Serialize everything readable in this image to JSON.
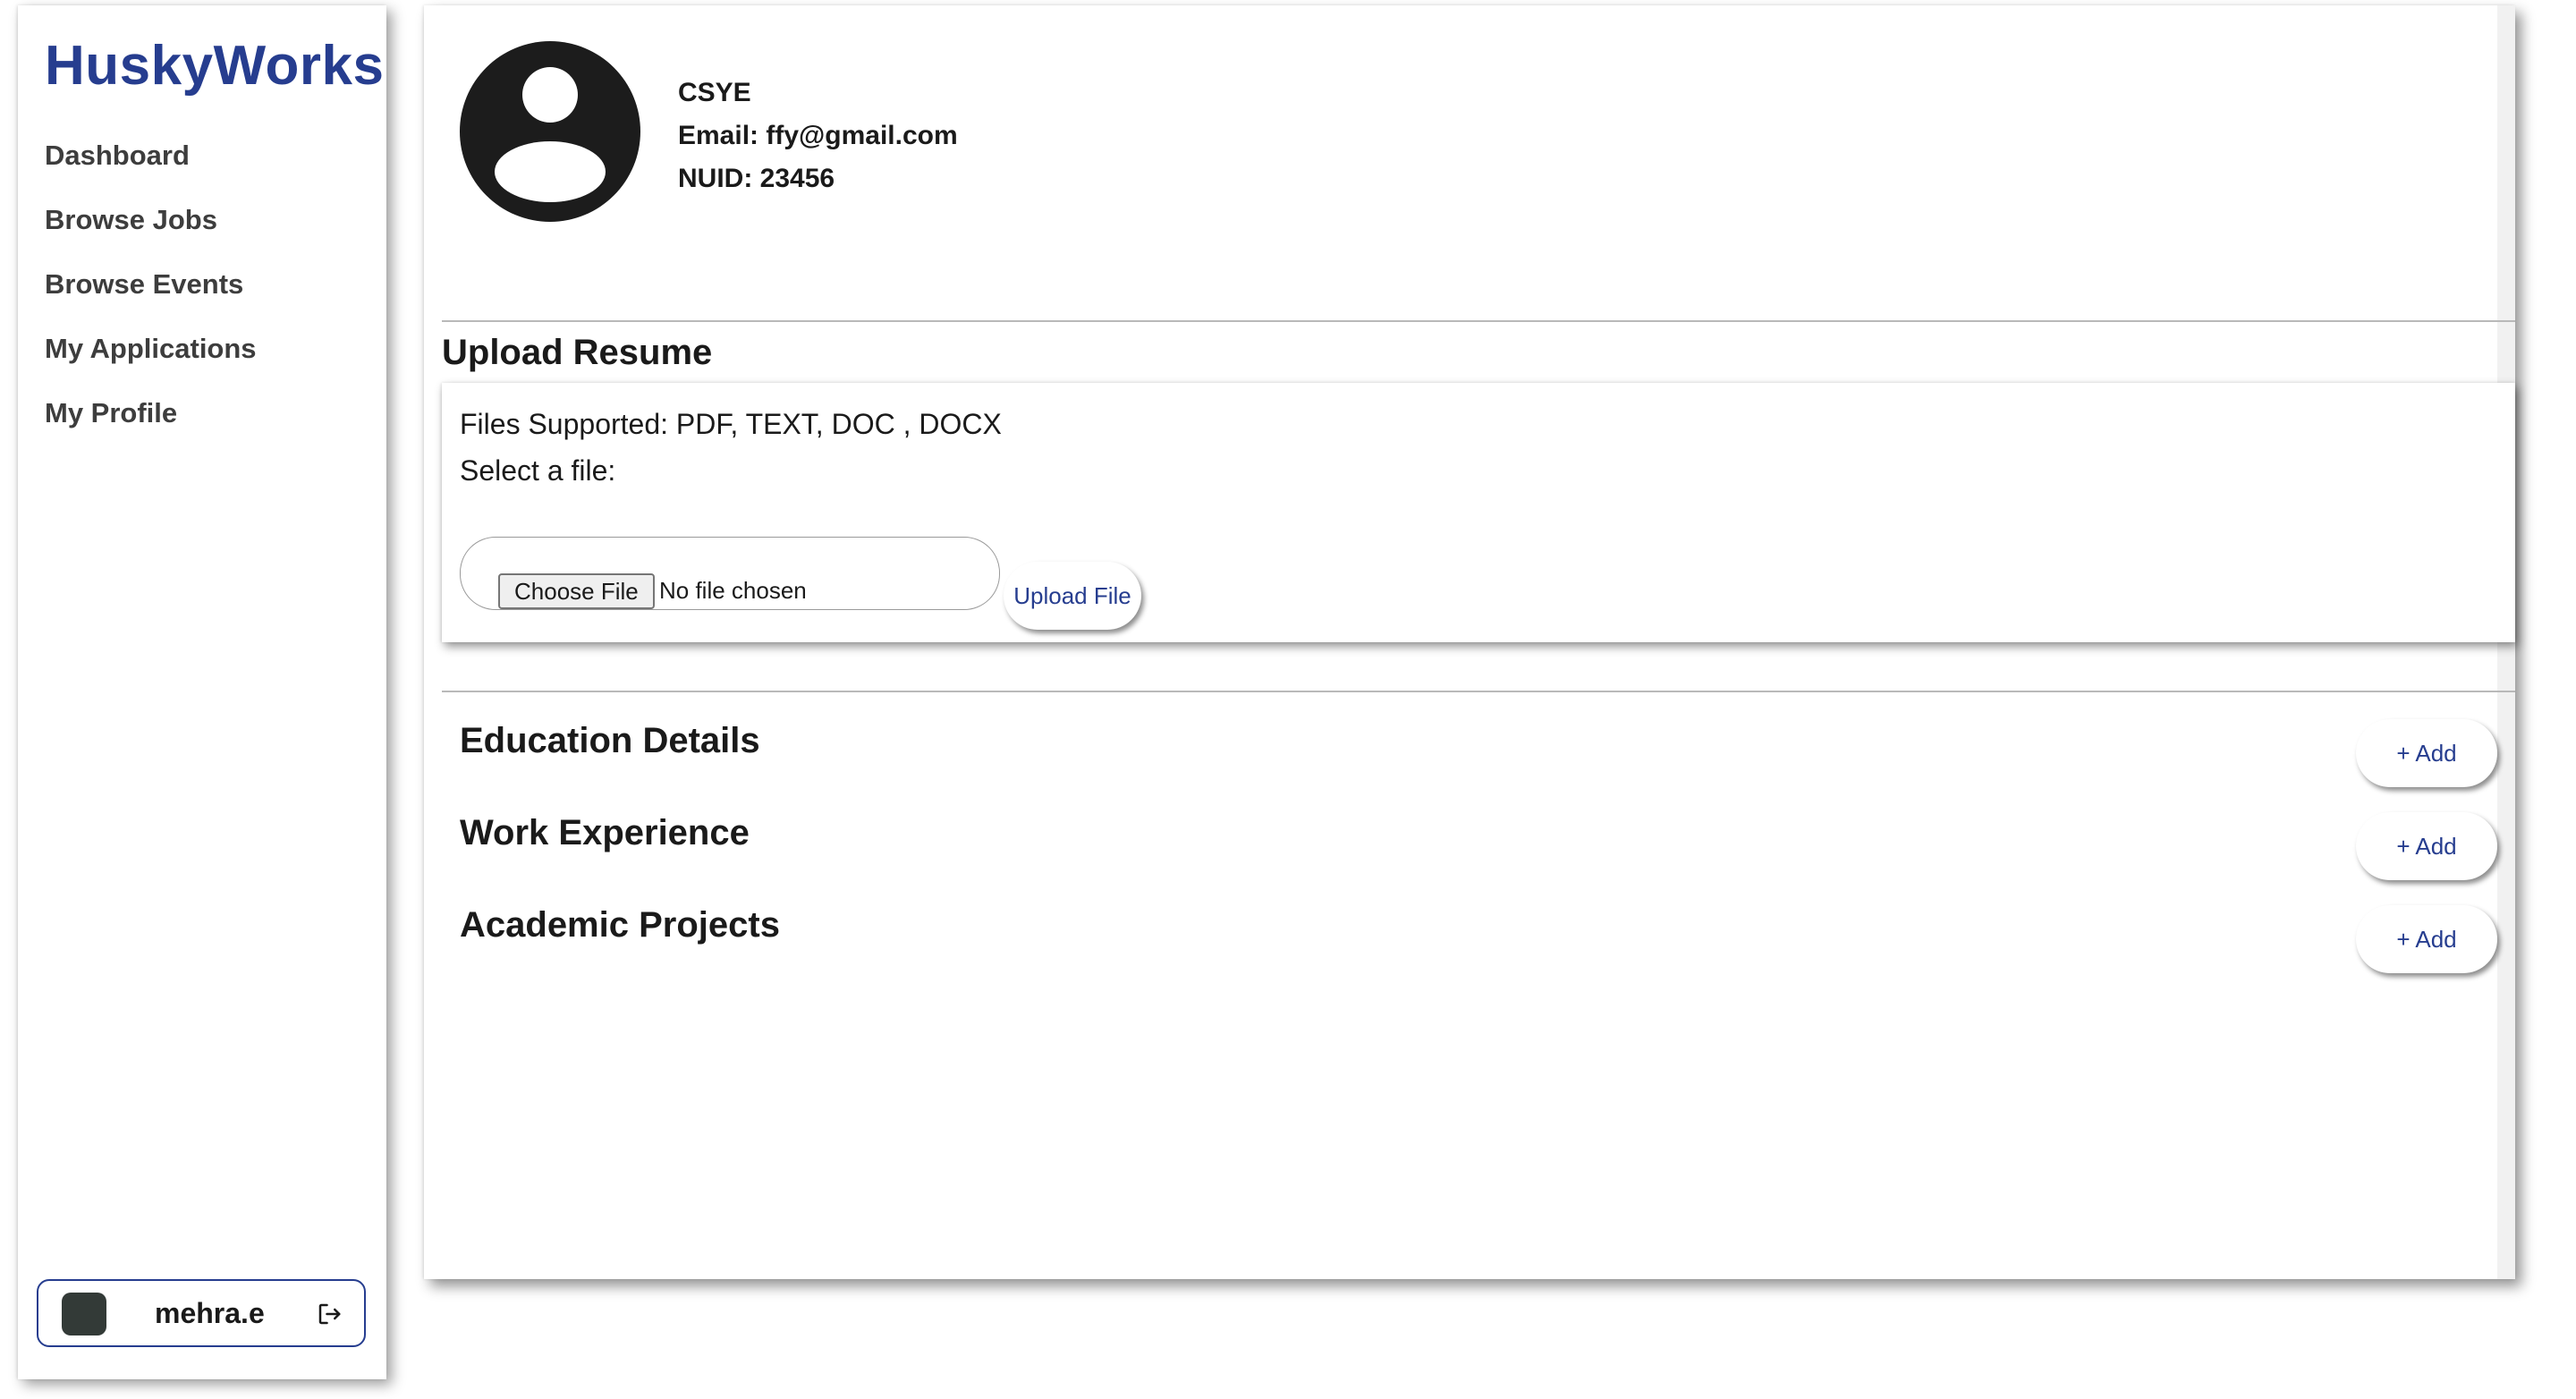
{
  "sidebar": {
    "brand": "HuskyWorks",
    "items": [
      {
        "label": "Dashboard"
      },
      {
        "label": "Browse Jobs"
      },
      {
        "label": "Browse Events"
      },
      {
        "label": "My Applications"
      },
      {
        "label": "My Profile"
      }
    ],
    "user": {
      "name": "mehra.e",
      "avatar_color": "#333a37",
      "logout_icon": "logout-icon"
    }
  },
  "profile": {
    "avatar_icon": "user-avatar-icon",
    "name": "CSYE",
    "email": "Email: ffy@gmail.com",
    "nuid": "NUID: 23456"
  },
  "upload_resume": {
    "title": "Upload Resume",
    "files_supported": "Files Supported: PDF, TEXT, DOC , DOCX",
    "select_label": "Select a file:",
    "choose_button": "Choose File",
    "no_file_text": "No file chosen",
    "upload_button": "Upload File"
  },
  "sections": [
    {
      "title": "Education Details",
      "add_label": "+ Add"
    },
    {
      "title": "Work Experience",
      "add_label": "+ Add"
    },
    {
      "title": "Academic Projects",
      "add_label": "+ Add"
    }
  ],
  "colors": {
    "brand": "#263d8f",
    "nav_text": "#3d3d3d",
    "text": "#1a1a1a",
    "divider": "#b9b9b9"
  }
}
